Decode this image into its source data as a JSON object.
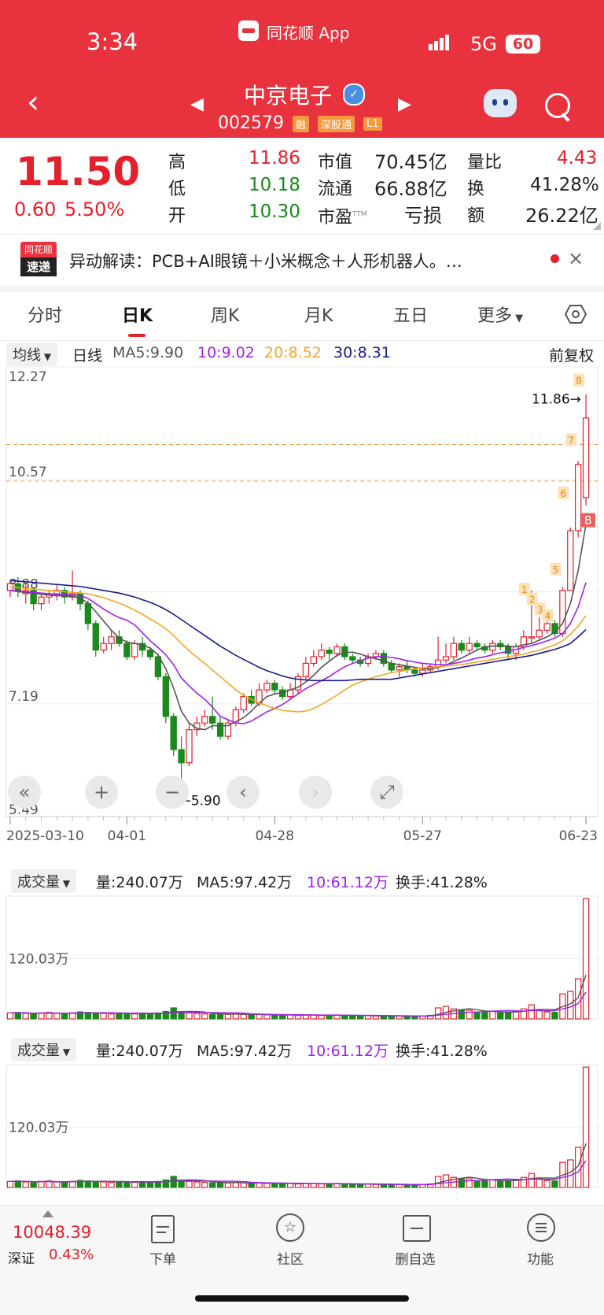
{
  "status_bar": {
    "time": "3:34",
    "app_label": "同花顺 App",
    "network": "5G",
    "battery": "60"
  },
  "header": {
    "stock_name": "中京电子",
    "stock_code": "002579",
    "tags": [
      "融",
      "深股通",
      "L1"
    ]
  },
  "quote": {
    "price": "11.50",
    "change": "0.60",
    "change_pct": "5.50%",
    "items": [
      {
        "label": "高",
        "value": "11.86"
      },
      {
        "label": "低",
        "value": "10.18"
      },
      {
        "label": "开",
        "value": "10.30"
      },
      {
        "label": "市值",
        "value": "70.45亿"
      },
      {
        "label": "流通",
        "value": "66.88亿"
      },
      {
        "label": "市盈",
        "sup": "TTM",
        "value": "亏损"
      },
      {
        "label": "量比",
        "value": "4.43"
      },
      {
        "label": "换",
        "value": "41.28%"
      },
      {
        "label": "额",
        "value": "26.22亿"
      }
    ]
  },
  "news": {
    "logo_top": "同花顺",
    "logo_bottom": "速递",
    "text": "异动解读：PCB+AI眼镜＋小米概念＋人形机器人。…"
  },
  "tabs": [
    "分时",
    "日K",
    "周K",
    "月K",
    "五日",
    "更多"
  ],
  "chart_header": {
    "indicator": "均线",
    "period": "日线",
    "ma5": "MA5:9.90",
    "ma10": "10:9.02",
    "ma20": "20:8.52",
    "ma30": "30:8.31",
    "adjust": "前复权"
  },
  "chart_data": {
    "type": "candlestick",
    "y_ticks": [
      "12.27",
      "10.57",
      "8.88",
      "7.19",
      "5.49"
    ],
    "x_ticks": [
      "2025-03-10",
      "04-01",
      "04-28",
      "05-27",
      "06-23"
    ],
    "high_label": "11.86→",
    "low_label": "←5.90",
    "markers": [
      "1",
      "2",
      "3",
      "4",
      "5",
      "6",
      "7",
      "8"
    ],
    "buy_marker": "B",
    "dashed_levels": [
      11.1,
      10.55
    ],
    "candles": [
      [
        8.9,
        9.0,
        9.05,
        8.8
      ],
      [
        9.0,
        8.9,
        9.1,
        8.8
      ],
      [
        8.85,
        8.9,
        9.0,
        8.7
      ],
      [
        8.9,
        8.7,
        8.95,
        8.6
      ],
      [
        8.7,
        8.8,
        8.85,
        8.6
      ],
      [
        8.8,
        8.85,
        8.9,
        8.7
      ],
      [
        8.85,
        8.9,
        9.0,
        8.75
      ],
      [
        8.9,
        8.8,
        8.95,
        8.7
      ],
      [
        8.8,
        8.85,
        9.2,
        8.75
      ],
      [
        8.85,
        8.7,
        8.9,
        8.6
      ],
      [
        8.7,
        8.4,
        8.75,
        8.3
      ],
      [
        8.4,
        8.0,
        8.45,
        7.9
      ],
      [
        8.0,
        8.1,
        8.2,
        7.95
      ],
      [
        8.1,
        8.2,
        8.3,
        8.0
      ],
      [
        8.2,
        8.1,
        8.3,
        8.05
      ],
      [
        8.1,
        7.9,
        8.15,
        7.85
      ],
      [
        7.9,
        8.1,
        8.15,
        7.85
      ],
      [
        8.1,
        8.0,
        8.2,
        7.9
      ],
      [
        8.0,
        7.9,
        8.05,
        7.85
      ],
      [
        7.9,
        7.6,
        7.95,
        7.55
      ],
      [
        7.6,
        7.0,
        7.65,
        6.9
      ],
      [
        7.0,
        6.5,
        7.05,
        6.4
      ],
      [
        6.5,
        6.3,
        6.7,
        5.9
      ],
      [
        6.3,
        6.8,
        6.9,
        6.25
      ],
      [
        6.8,
        6.9,
        7.0,
        6.7
      ],
      [
        6.9,
        7.0,
        7.1,
        6.85
      ],
      [
        7.0,
        6.9,
        7.3,
        6.8
      ],
      [
        6.9,
        6.7,
        7.0,
        6.65
      ],
      [
        6.7,
        6.9,
        6.95,
        6.65
      ],
      [
        6.9,
        7.1,
        7.15,
        6.85
      ],
      [
        7.1,
        7.3,
        7.35,
        7.05
      ],
      [
        7.3,
        7.2,
        7.4,
        7.15
      ],
      [
        7.2,
        7.4,
        7.5,
        7.15
      ],
      [
        7.4,
        7.5,
        7.55,
        7.35
      ],
      [
        7.5,
        7.4,
        7.55,
        7.35
      ],
      [
        7.4,
        7.3,
        7.45,
        7.25
      ],
      [
        7.3,
        7.4,
        7.5,
        7.25
      ],
      [
        7.4,
        7.6,
        7.65,
        7.35
      ],
      [
        7.6,
        7.8,
        7.9,
        7.55
      ],
      [
        7.8,
        7.9,
        8.0,
        7.75
      ],
      [
        7.9,
        8.0,
        8.1,
        7.85
      ],
      [
        8.0,
        7.95,
        8.05,
        7.85
      ],
      [
        7.95,
        8.05,
        8.1,
        7.9
      ],
      [
        8.05,
        7.9,
        8.1,
        7.85
      ],
      [
        7.9,
        7.85,
        7.95,
        7.8
      ],
      [
        7.85,
        7.8,
        7.9,
        7.75
      ],
      [
        7.8,
        7.9,
        7.95,
        7.75
      ],
      [
        7.9,
        7.95,
        8.0,
        7.85
      ],
      [
        7.95,
        7.8,
        8.0,
        7.75
      ],
      [
        7.8,
        7.7,
        7.85,
        7.65
      ],
      [
        7.7,
        7.75,
        7.8,
        7.6
      ],
      [
        7.75,
        7.7,
        7.85,
        7.65
      ],
      [
        7.7,
        7.65,
        7.75,
        7.6
      ],
      [
        7.65,
        7.7,
        7.8,
        7.6
      ],
      [
        7.7,
        7.75,
        7.8,
        7.65
      ],
      [
        7.75,
        7.85,
        8.2,
        7.7
      ],
      [
        7.85,
        7.9,
        8.1,
        7.8
      ],
      [
        7.9,
        8.1,
        8.2,
        7.85
      ],
      [
        8.1,
        8.0,
        8.15,
        7.95
      ],
      [
        8.0,
        8.1,
        8.2,
        7.95
      ],
      [
        8.1,
        8.05,
        8.15,
        8.0
      ],
      [
        8.05,
        8.0,
        8.1,
        7.95
      ],
      [
        8.0,
        8.1,
        8.15,
        7.95
      ],
      [
        8.1,
        8.05,
        8.15,
        8.0
      ],
      [
        8.05,
        7.95,
        8.1,
        7.85
      ],
      [
        7.95,
        8.05,
        8.1,
        7.85
      ],
      [
        8.05,
        8.2,
        8.3,
        8.0
      ],
      [
        8.2,
        8.2,
        8.9,
        8.1
      ],
      [
        8.2,
        8.3,
        8.5,
        8.15
      ],
      [
        8.3,
        8.4,
        8.6,
        8.25
      ],
      [
        8.4,
        8.25,
        8.45,
        8.2
      ],
      [
        8.25,
        8.9,
        8.95,
        8.2
      ],
      [
        8.9,
        9.8,
        9.85,
        8.9
      ],
      [
        9.8,
        10.8,
        10.85,
        9.7
      ],
      [
        10.3,
        11.5,
        11.86,
        10.18
      ]
    ],
    "ma_series": [
      {
        "name": "MA5",
        "color": "#555555",
        "values": [
          8.9,
          8.88,
          8.87,
          8.86,
          8.84,
          8.83,
          8.82,
          8.82,
          8.81,
          8.78,
          8.71,
          8.58,
          8.44,
          8.3,
          8.18,
          8.12,
          8.1,
          8.08,
          8.03,
          7.93,
          7.72,
          7.43,
          7.08,
          6.9,
          6.82,
          6.8,
          6.86,
          6.86,
          6.86,
          6.92,
          6.98,
          7.08,
          7.2,
          7.3,
          7.34,
          7.36,
          7.4,
          7.44,
          7.52,
          7.62,
          7.74,
          7.83,
          7.92,
          7.96,
          7.97,
          7.94,
          7.9,
          7.87,
          7.84,
          7.8,
          7.78,
          7.76,
          7.74,
          7.72,
          7.72,
          7.74,
          7.77,
          7.83,
          7.88,
          7.94,
          8.0,
          8.05,
          8.06,
          8.07,
          8.06,
          8.05,
          8.08,
          8.1,
          8.15,
          8.2,
          8.27,
          8.4,
          8.7,
          9.2,
          9.9
        ]
      },
      {
        "name": "MA10",
        "color": "#a020f0",
        "values": [
          8.9,
          8.89,
          8.88,
          8.87,
          8.86,
          8.85,
          8.84,
          8.84,
          8.83,
          8.82,
          8.78,
          8.7,
          8.62,
          8.55,
          8.49,
          8.45,
          8.38,
          8.26,
          8.14,
          8.04,
          7.93,
          7.78,
          7.58,
          7.46,
          7.35,
          7.26,
          7.14,
          7.0,
          6.95,
          6.9,
          6.89,
          6.93,
          7.0,
          7.07,
          7.12,
          7.18,
          7.26,
          7.34,
          7.42,
          7.48,
          7.54,
          7.6,
          7.68,
          7.75,
          7.8,
          7.84,
          7.88,
          7.9,
          7.9,
          7.89,
          7.87,
          7.84,
          7.82,
          7.8,
          7.79,
          7.78,
          7.78,
          7.8,
          7.82,
          7.85,
          7.88,
          7.9,
          7.93,
          7.96,
          7.98,
          8.01,
          8.04,
          8.07,
          8.1,
          8.14,
          8.18,
          8.25,
          8.4,
          8.65,
          9.02
        ]
      },
      {
        "name": "MA20",
        "color": "#f5a623",
        "values": [
          8.95,
          8.94,
          8.93,
          8.92,
          8.91,
          8.9,
          8.89,
          8.88,
          8.87,
          8.86,
          8.85,
          8.82,
          8.79,
          8.75,
          8.71,
          8.66,
          8.6,
          8.54,
          8.47,
          8.4,
          8.32,
          8.22,
          8.1,
          7.99,
          7.89,
          7.8,
          7.7,
          7.6,
          7.5,
          7.4,
          7.32,
          7.26,
          7.2,
          7.16,
          7.12,
          7.09,
          7.08,
          7.07,
          7.08,
          7.12,
          7.18,
          7.25,
          7.32,
          7.4,
          7.47,
          7.52,
          7.56,
          7.6,
          7.63,
          7.66,
          7.68,
          7.7,
          7.72,
          7.73,
          7.74,
          7.75,
          7.76,
          7.77,
          7.78,
          7.8,
          7.82,
          7.84,
          7.86,
          7.88,
          7.9,
          7.92,
          7.94,
          7.97,
          8.0,
          8.04,
          8.08,
          8.14,
          8.24,
          8.36,
          8.52
        ]
      },
      {
        "name": "MA30",
        "color": "#1a1a8c",
        "values": [
          9.05,
          9.04,
          9.03,
          9.02,
          9.01,
          9.0,
          8.99,
          8.98,
          8.97,
          8.96,
          8.94,
          8.92,
          8.9,
          8.88,
          8.86,
          8.83,
          8.8,
          8.76,
          8.72,
          8.67,
          8.61,
          8.54,
          8.46,
          8.38,
          8.3,
          8.22,
          8.14,
          8.06,
          7.99,
          7.92,
          7.86,
          7.8,
          7.74,
          7.69,
          7.65,
          7.61,
          7.58,
          7.56,
          7.55,
          7.54,
          7.54,
          7.54,
          7.54,
          7.54,
          7.55,
          7.56,
          7.56,
          7.56,
          7.56,
          7.56,
          7.58,
          7.6,
          7.62,
          7.64,
          7.66,
          7.68,
          7.7,
          7.72,
          7.74,
          7.76,
          7.78,
          7.8,
          7.82,
          7.84,
          7.86,
          7.88,
          7.9,
          7.92,
          7.95,
          7.98,
          8.01,
          8.05,
          8.1,
          8.2,
          8.31
        ]
      }
    ],
    "volume": {
      "label": "成交量",
      "vol": "量:240.07万",
      "ma5": "MA5:97.42万",
      "ma10": "10:61.12万",
      "turnover": "换手:41.28%",
      "tick": "120.03万",
      "values": [
        12,
        13,
        11,
        10,
        12,
        13,
        11,
        10,
        12,
        14,
        13,
        12,
        11,
        10,
        12,
        11,
        10,
        11,
        10,
        12,
        15,
        22,
        14,
        12,
        11,
        10,
        9,
        10,
        9,
        10,
        9,
        8,
        9,
        8,
        8,
        7,
        8,
        7,
        8,
        8,
        7,
        7,
        8,
        7,
        6,
        6,
        7,
        6,
        6,
        5,
        6,
        5,
        6,
        6,
        7,
        22,
        25,
        20,
        18,
        17,
        12,
        13,
        15,
        12,
        14,
        15,
        20,
        28,
        18,
        14,
        13,
        50,
        55,
        80,
        240
      ]
    }
  },
  "chart_controls": [
    "«",
    "+",
    "−",
    "‹",
    "›",
    "⤢"
  ],
  "bottom_nav": {
    "index_value": "10048.39",
    "index_name": "深证",
    "index_pct": "0.43%",
    "items": [
      "下单",
      "社区",
      "删自选",
      "功能"
    ]
  }
}
